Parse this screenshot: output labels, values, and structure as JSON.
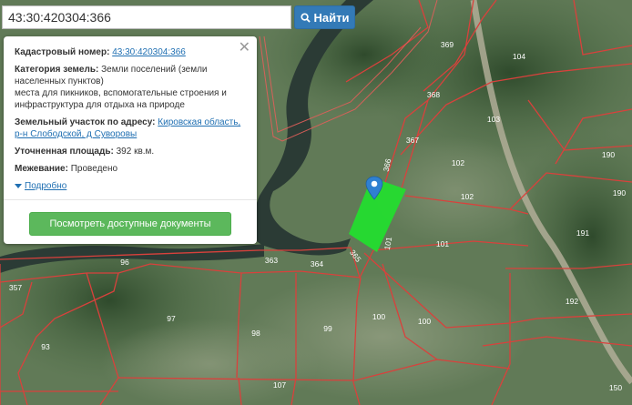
{
  "search": {
    "value": "43:30:420304:366",
    "button_label": "Найти"
  },
  "popup": {
    "cadastral_label": "Кадастровый номер:",
    "cadastral_value": "43:30:420304:366",
    "category_label": "Категория земель:",
    "category_value": "Земли поселений (земли населенных пунктов)",
    "category_extra": "места для пикников, вспомогательные строения и инфраструктура для отдыха на природе",
    "address_label": "Земельный участок по адресу:",
    "address_value": "Кировская область, р-н Слободской, д Суворовы",
    "area_label": "Уточненная площадь:",
    "area_value": "392 кв.м.",
    "survey_label": "Межевание:",
    "survey_value": "Проведено",
    "details_label": "Подробно",
    "docs_button": "Посмотреть доступные документы",
    "close_glyph": "✕"
  },
  "map": {
    "parcel_labels": [
      {
        "id": "369",
        "text": "369"
      },
      {
        "id": "104",
        "text": "104"
      },
      {
        "id": "368",
        "text": "368"
      },
      {
        "id": "103",
        "text": "103"
      },
      {
        "id": "367",
        "text": "367"
      },
      {
        "id": "102a",
        "text": "102"
      },
      {
        "id": "102b",
        "text": "102"
      },
      {
        "id": "190a",
        "text": "190"
      },
      {
        "id": "190b",
        "text": "190"
      },
      {
        "id": "191",
        "text": "191"
      },
      {
        "id": "101a",
        "text": "101"
      },
      {
        "id": "101b",
        "text": "101"
      },
      {
        "id": "366",
        "text": "366"
      },
      {
        "id": "365",
        "text": "365"
      },
      {
        "id": "364",
        "text": "364"
      },
      {
        "id": "363",
        "text": "363"
      },
      {
        "id": "96",
        "text": "96"
      },
      {
        "id": "357",
        "text": "357"
      },
      {
        "id": "97",
        "text": "97"
      },
      {
        "id": "98",
        "text": "98"
      },
      {
        "id": "99",
        "text": "99"
      },
      {
        "id": "100a",
        "text": "100"
      },
      {
        "id": "100b",
        "text": "100"
      },
      {
        "id": "192",
        "text": "192"
      },
      {
        "id": "93",
        "text": "93"
      },
      {
        "id": "107",
        "text": "107"
      },
      {
        "id": "150",
        "text": "150"
      }
    ],
    "colors": {
      "boundary": "#d9413c",
      "selected_parcel": "#22e02e",
      "marker": "#2f80d1",
      "water": "#2b3b35"
    }
  }
}
